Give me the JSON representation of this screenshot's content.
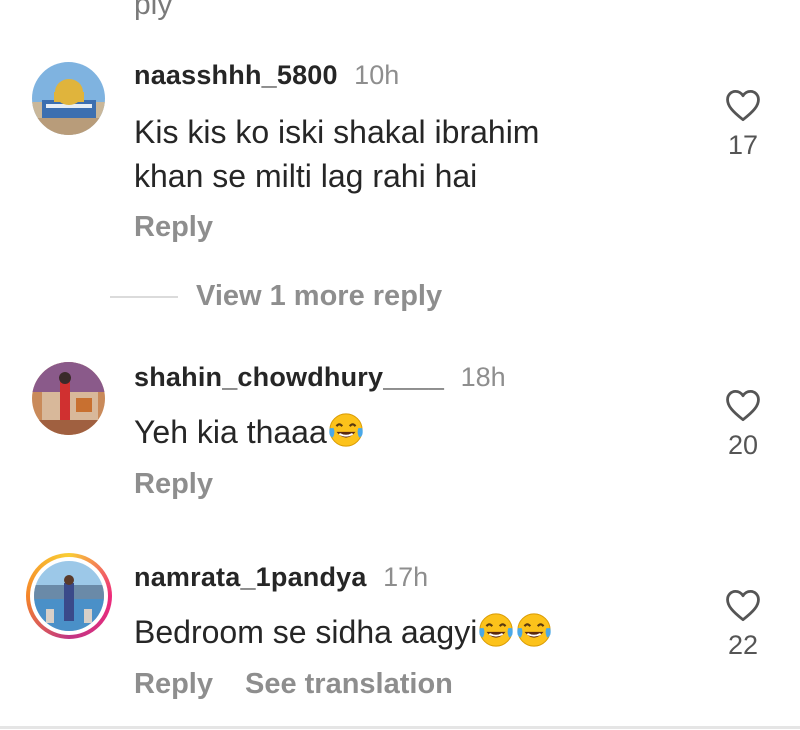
{
  "top_partial_text": "ply",
  "comments": [
    {
      "username": "naasshhh_5800",
      "time": "10h",
      "text_line1": "Kis kis ko iski shakal ibrahim",
      "text_line2": "khan se milti lag rahi hai",
      "reply_label": "Reply",
      "likes": "17"
    },
    {
      "username": "shahin_chowdhury____",
      "time": "18h",
      "text": "Yeh kia thaaa",
      "reply_label": "Reply",
      "likes": "20"
    },
    {
      "username": "namrata_1pandya",
      "time": "17h",
      "text": "Bedroom se sidha aagyi",
      "reply_label": "Reply",
      "translate_label": "See translation",
      "likes": "22"
    }
  ],
  "view_more_replies": "View 1 more reply",
  "icons": {
    "like": "heart-outline-icon",
    "emoji": "face-with-tears-of-joy"
  },
  "colors": {
    "muted": "#8e8e8e",
    "text": "#262626",
    "ring": "#ee2a7b"
  }
}
